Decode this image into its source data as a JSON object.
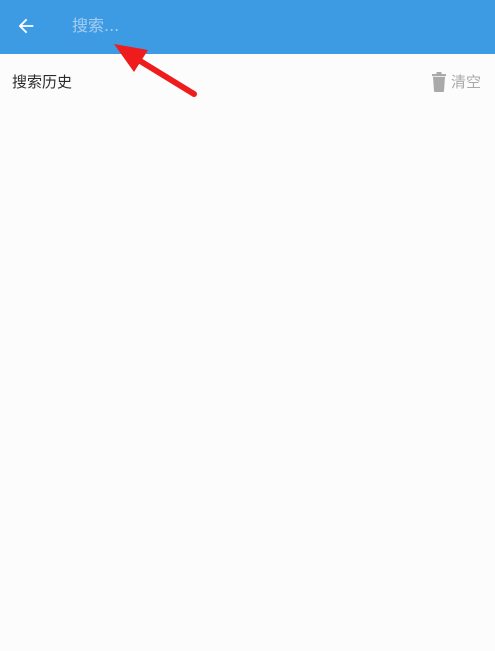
{
  "colors": {
    "accent": "#3d9be4",
    "placeholder": "#a6cdf1",
    "annotation_arrow": "#ee1c1c"
  },
  "topbar": {
    "back_icon": "arrow-left-icon",
    "search_placeholder": "搜索...",
    "search_value": ""
  },
  "history": {
    "title": "搜索历史",
    "clear_icon": "trash-icon",
    "clear_label": "清空",
    "items": []
  }
}
